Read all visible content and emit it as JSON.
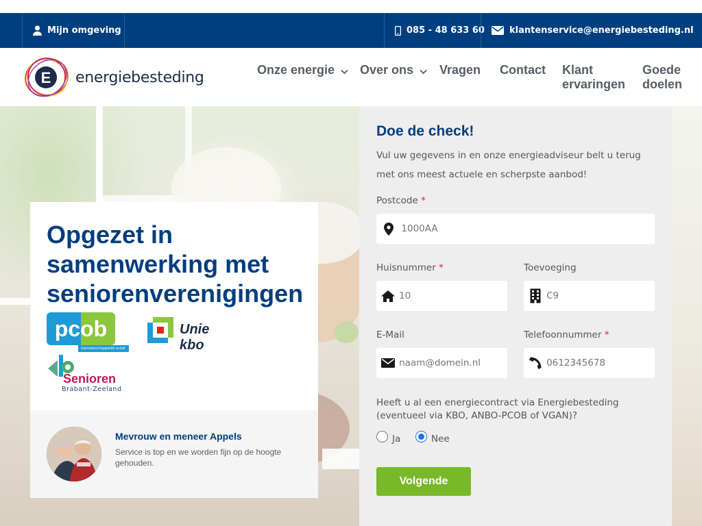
{
  "topbar": {
    "my_env_label": "Mijn omgeving",
    "phone": "085 - 48 633 60",
    "email": "klantenservice@energiebesteding.nl"
  },
  "brand": {
    "letter": "E",
    "name": "energiebesteding"
  },
  "nav": {
    "items": [
      {
        "label": "Onze energie"
      },
      {
        "label": "Over ons"
      },
      {
        "label": "Vragen"
      },
      {
        "label": "Contact"
      },
      {
        "label_line1": "Klant",
        "label_line2": "ervaringen"
      },
      {
        "label_line1": "Goede",
        "label_line2": "doelen"
      }
    ]
  },
  "card": {
    "heading": "Opgezet in samenwerking met seniorenverenigingen",
    "partners": {
      "pcob": "pcob",
      "pcob_tagline": "Gemeenschappelijk actief",
      "unie_kbo": "Unie kbo",
      "senioren": "Senioren",
      "senioren_region": "Brabant-Zeeland"
    },
    "testimonial": {
      "name": "Mevrouw en meneer Appels",
      "text": "Service is top en we worden fijn op de hoogte gehouden."
    }
  },
  "form": {
    "title": "Doe de check!",
    "intro": "Vul uw gegevens in en onze energieadviseur belt u terug met ons meest actuele en scherpste aanbod!",
    "postcode": {
      "label": "Postcode",
      "placeholder": "1000AA"
    },
    "huisnummer": {
      "label": "Huisnummer",
      "placeholder": "10"
    },
    "toevoeging": {
      "label": "Toevoeging",
      "placeholder": "C9"
    },
    "email": {
      "label": "E-Mail",
      "placeholder": "naam@domein.nl"
    },
    "telefoon": {
      "label": "Telefoonnummer",
      "placeholder": "0612345678"
    },
    "required_mark": "*",
    "question": "Heeft u al een energiecontract via Energiebesteding (eventueel via KBO, ANBO-PCOB of VGAN)?",
    "options": {
      "yes": "Ja",
      "no": "Nee",
      "selected": "no"
    },
    "submit": "Volgende"
  },
  "colors": {
    "topbar": "#003f7f",
    "heading_blue": "#003e7e",
    "button_green": "#79b829",
    "form_bg": "#eeeeee"
  }
}
